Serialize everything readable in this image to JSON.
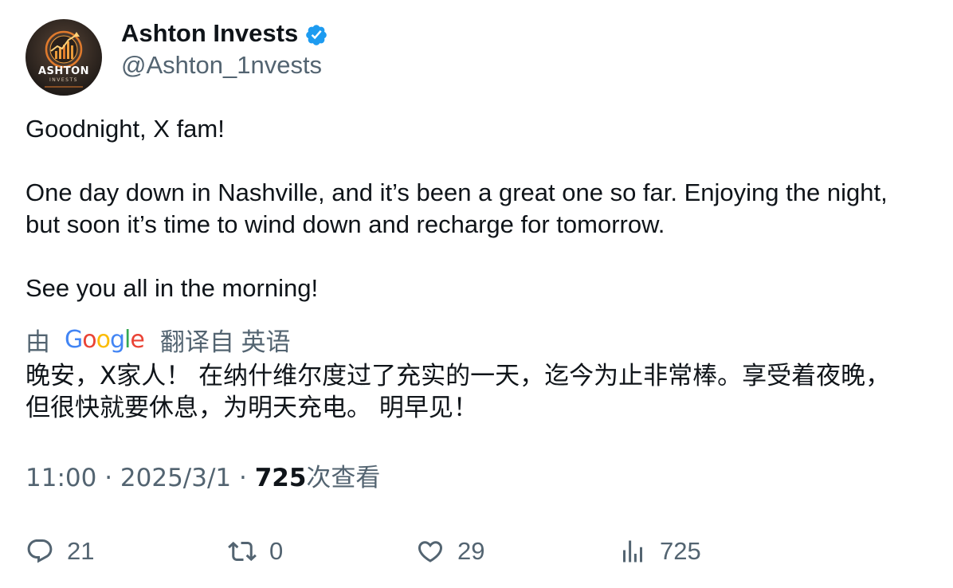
{
  "author": {
    "display_name": "Ashton Invests",
    "handle": "@Ashton_1nvests",
    "verified": true,
    "avatar_text": "ASHTON",
    "avatar_subtext": "INVESTS"
  },
  "tweet": {
    "paragraphs": [
      "Goodnight, X fam!",
      "One day down in Nashville, and it’s been a great one so far. Enjoying the night,\nbut soon it’s time to wind down and recharge for tomorrow.",
      "See you all in the morning!"
    ]
  },
  "translation": {
    "prefix": "由",
    "provider": "Google",
    "suffix": "翻译自 英语",
    "text": "晚安，X家人！ 在纳什维尔度过了充实的一天，迄今为止非常棒。享受着夜晚，\n但很快就要休息，为明天充电。 明早见！"
  },
  "meta": {
    "time": "11:00",
    "separator": " · ",
    "date": "2025/3/1",
    "views_count": "725",
    "views_label": "次查看"
  },
  "actions": {
    "replies": "21",
    "retweets": "0",
    "likes": "29",
    "views": "725"
  },
  "colors": {
    "text_primary": "#0f1419",
    "text_secondary": "#536471",
    "verified_blue": "#1d9bf0"
  },
  "icons": {
    "verified": "verified-badge-icon",
    "reply": "reply-icon",
    "retweet": "retweet-icon",
    "like": "heart-icon",
    "views": "analytics-icon"
  }
}
